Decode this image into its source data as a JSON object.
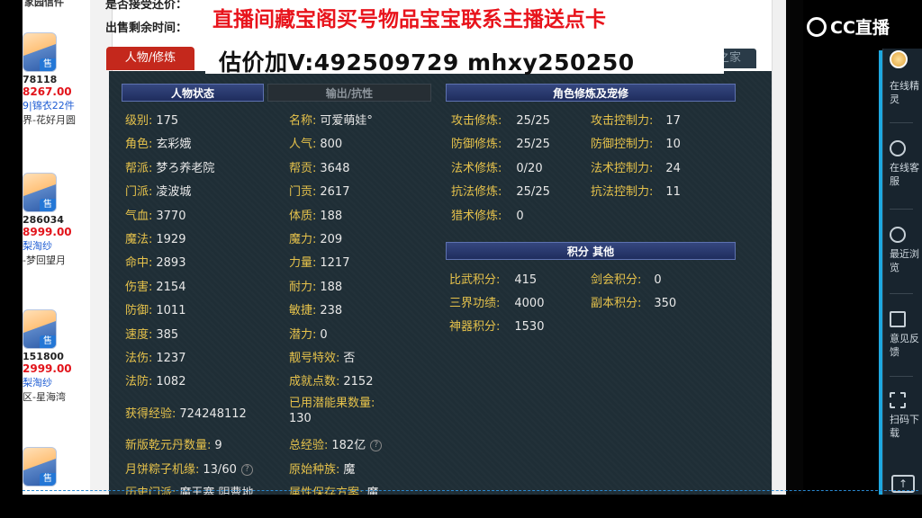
{
  "left_column": {
    "top_label": "家园信件",
    "products": [
      {
        "id": "78118",
        "price": "8267.00",
        "link": "9|锦衣22件",
        "server": "界-花好月圆",
        "badge": "售"
      },
      {
        "id": "286034",
        "price": "8999.00",
        "link": "梨淘纱",
        "server": "-梦回望月",
        "badge": "售"
      },
      {
        "id": "151800",
        "price": "2999.00",
        "link": "梨淘纱",
        "server": "区-星海湾",
        "badge": "售"
      },
      {
        "id": "",
        "price": "",
        "link": "",
        "server": "",
        "badge": "售"
      }
    ]
  },
  "header": {
    "top_partial": "是否接受还价：",
    "sell_time_label": "出售剩余时间："
  },
  "banner": {
    "line1": "直播间藏宝阁买号物品宝宝联系主播送点卡",
    "line2": "估价加V:492509729    mhxy250250"
  },
  "tabs": {
    "active": "人物/修炼",
    "home": "之家"
  },
  "sections": {
    "status_active": "人物状态",
    "status_inactive": "输出/抗性",
    "cultivation": "角色修炼及宠修",
    "score": "积分 其他"
  },
  "character": {
    "left": [
      {
        "k": "级别:",
        "v": "175"
      },
      {
        "k": "角色:",
        "v": "玄彩娥"
      },
      {
        "k": "帮派:",
        "v": "梦ろ养老院"
      },
      {
        "k": "门派:",
        "v": "凌波城"
      },
      {
        "k": "气血:",
        "v": "3770"
      },
      {
        "k": "魔法:",
        "v": "1929"
      },
      {
        "k": "命中:",
        "v": "2893"
      },
      {
        "k": "伤害:",
        "v": "2154"
      },
      {
        "k": "防御:",
        "v": "1011"
      },
      {
        "k": "速度:",
        "v": "385"
      },
      {
        "k": "法伤:",
        "v": "1237"
      },
      {
        "k": "法防:",
        "v": "1082"
      },
      {
        "k": "获得经验:",
        "v": "724248112"
      },
      {
        "k": "新版乾元丹数量:",
        "v": "9"
      },
      {
        "k": "月饼粽子机缘:",
        "v": "13/60"
      },
      {
        "k": "历史门派:",
        "v": "魔王寨,阴曹地"
      }
    ],
    "right": [
      {
        "k": "名称:",
        "v": "可爱萌娃°"
      },
      {
        "k": "人气:",
        "v": "800"
      },
      {
        "k": "帮贡:",
        "v": "3648"
      },
      {
        "k": "门贡:",
        "v": "2617"
      },
      {
        "k": "体质:",
        "v": "188"
      },
      {
        "k": "魔力:",
        "v": "209"
      },
      {
        "k": "力量:",
        "v": "1217"
      },
      {
        "k": "耐力:",
        "v": "188"
      },
      {
        "k": "敏捷:",
        "v": "238"
      },
      {
        "k": "潜力:",
        "v": "0"
      },
      {
        "k": "靓号特效:",
        "v": "否"
      },
      {
        "k": "成就点数:",
        "v": "2152"
      },
      {
        "k": "已用潜能果数量:",
        "v": "130"
      },
      {
        "k": "总经验:",
        "v": "182亿"
      },
      {
        "k": "原始种族:",
        "v": "魔"
      },
      {
        "k": "属性保存方案:",
        "v": "魔"
      }
    ]
  },
  "cultivation": {
    "left": [
      {
        "k": "攻击修炼:",
        "v": "25/25"
      },
      {
        "k": "防御修炼:",
        "v": "25/25"
      },
      {
        "k": "法术修炼:",
        "v": "0/20"
      },
      {
        "k": "抗法修炼:",
        "v": "25/25"
      },
      {
        "k": "猎术修炼:",
        "v": "0"
      }
    ],
    "right": [
      {
        "k": "攻击控制力:",
        "v": "17"
      },
      {
        "k": "防御控制力:",
        "v": "10"
      },
      {
        "k": "法术控制力:",
        "v": "24"
      },
      {
        "k": "抗法控制力:",
        "v": "11"
      }
    ]
  },
  "scores": {
    "left": [
      {
        "k": "比武积分:",
        "v": "415"
      },
      {
        "k": "三界功绩:",
        "v": "4000"
      },
      {
        "k": "神器积分:",
        "v": "1530"
      }
    ],
    "right": [
      {
        "k": "剑会积分:",
        "v": "0"
      },
      {
        "k": "副本积分:",
        "v": "350"
      }
    ]
  },
  "cc_panel": {
    "logo": "CC直播",
    "items": [
      "在线精灵",
      "在线客服",
      "最近浏览",
      "意见反馈",
      "扫码下载"
    ]
  }
}
